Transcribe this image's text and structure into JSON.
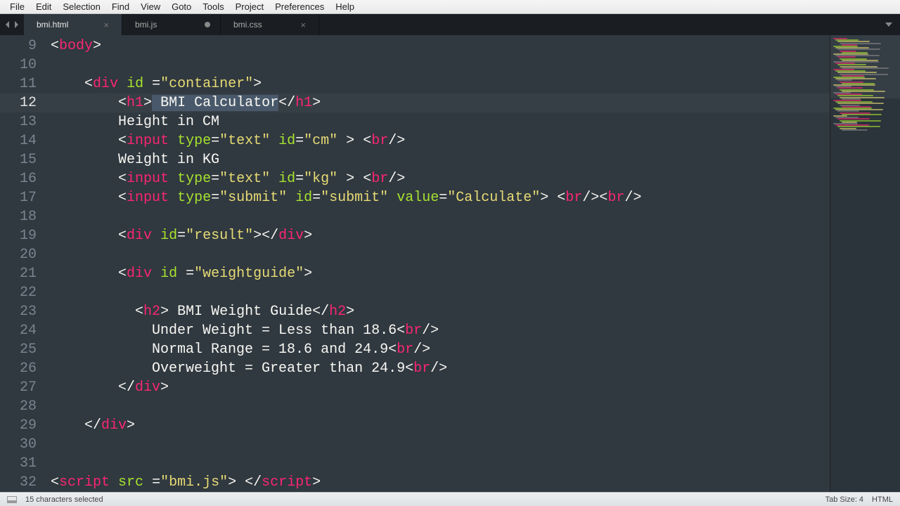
{
  "menu": {
    "items": [
      "File",
      "Edit",
      "Selection",
      "Find",
      "View",
      "Goto",
      "Tools",
      "Project",
      "Preferences",
      "Help"
    ]
  },
  "tabs": {
    "items": [
      {
        "label": "bmi.html",
        "active": true,
        "dirty": false
      },
      {
        "label": "bmi.js",
        "active": false,
        "dirty": true
      },
      {
        "label": "bmi.css",
        "active": false,
        "dirty": false
      }
    ]
  },
  "editor": {
    "first_line": 9,
    "active_line": 12,
    "selection_text": " BMI Calculator",
    "lines": [
      {
        "n": 9,
        "tokens": [
          [
            "<",
            "punct"
          ],
          [
            "body",
            "tag"
          ],
          [
            ">",
            "punct"
          ]
        ]
      },
      {
        "n": 10,
        "tokens": []
      },
      {
        "n": 11,
        "tokens": [
          [
            "    ",
            "plain"
          ],
          [
            "<",
            "punct"
          ],
          [
            "div",
            "tag"
          ],
          [
            " ",
            "plain"
          ],
          [
            "id",
            "attr"
          ],
          [
            " =",
            "plain"
          ],
          [
            "\"container\"",
            "str"
          ],
          [
            ">",
            "punct"
          ]
        ]
      },
      {
        "n": 12,
        "tokens": [
          [
            "        ",
            "plain"
          ],
          [
            "<",
            "punct"
          ],
          [
            "h1",
            "tag"
          ],
          [
            ">",
            "punct"
          ],
          [
            " BMI Calculator",
            "plain",
            "sel"
          ],
          [
            "</",
            "punct"
          ],
          [
            "h1",
            "tag"
          ],
          [
            ">",
            "punct"
          ]
        ]
      },
      {
        "n": 13,
        "tokens": [
          [
            "        Height in CM",
            "plain"
          ]
        ]
      },
      {
        "n": 14,
        "tokens": [
          [
            "        ",
            "plain"
          ],
          [
            "<",
            "punct"
          ],
          [
            "input",
            "tag"
          ],
          [
            " ",
            "plain"
          ],
          [
            "type",
            "attr"
          ],
          [
            "=",
            "plain"
          ],
          [
            "\"text\"",
            "str"
          ],
          [
            " ",
            "plain"
          ],
          [
            "id",
            "attr"
          ],
          [
            "=",
            "plain"
          ],
          [
            "\"cm\"",
            "str"
          ],
          [
            " > ",
            "plain"
          ],
          [
            "<",
            "punct"
          ],
          [
            "br",
            "tag"
          ],
          [
            "/>",
            "punct"
          ]
        ]
      },
      {
        "n": 15,
        "tokens": [
          [
            "        Weight in KG",
            "plain"
          ]
        ]
      },
      {
        "n": 16,
        "tokens": [
          [
            "        ",
            "plain"
          ],
          [
            "<",
            "punct"
          ],
          [
            "input",
            "tag"
          ],
          [
            " ",
            "plain"
          ],
          [
            "type",
            "attr"
          ],
          [
            "=",
            "plain"
          ],
          [
            "\"text\"",
            "str"
          ],
          [
            " ",
            "plain"
          ],
          [
            "id",
            "attr"
          ],
          [
            "=",
            "plain"
          ],
          [
            "\"kg\"",
            "str"
          ],
          [
            " > ",
            "plain"
          ],
          [
            "<",
            "punct"
          ],
          [
            "br",
            "tag"
          ],
          [
            "/>",
            "punct"
          ]
        ]
      },
      {
        "n": 17,
        "tokens": [
          [
            "        ",
            "plain"
          ],
          [
            "<",
            "punct"
          ],
          [
            "input",
            "tag"
          ],
          [
            " ",
            "plain"
          ],
          [
            "type",
            "attr"
          ],
          [
            "=",
            "plain"
          ],
          [
            "\"submit\"",
            "str"
          ],
          [
            " ",
            "plain"
          ],
          [
            "id",
            "attr"
          ],
          [
            "=",
            "plain"
          ],
          [
            "\"submit\"",
            "str"
          ],
          [
            " ",
            "plain"
          ],
          [
            "value",
            "attr"
          ],
          [
            "=",
            "plain"
          ],
          [
            "\"Calculate\"",
            "str"
          ],
          [
            "> ",
            "plain"
          ],
          [
            "<",
            "punct"
          ],
          [
            "br",
            "tag"
          ],
          [
            "/><",
            "punct"
          ],
          [
            "br",
            "tag"
          ],
          [
            "/>",
            "punct"
          ]
        ]
      },
      {
        "n": 18,
        "tokens": []
      },
      {
        "n": 19,
        "tokens": [
          [
            "        ",
            "plain"
          ],
          [
            "<",
            "punct"
          ],
          [
            "div",
            "tag"
          ],
          [
            " ",
            "plain"
          ],
          [
            "id",
            "attr"
          ],
          [
            "=",
            "plain"
          ],
          [
            "\"result\"",
            "str"
          ],
          [
            "></",
            "punct"
          ],
          [
            "div",
            "tag"
          ],
          [
            ">",
            "punct"
          ]
        ]
      },
      {
        "n": 20,
        "tokens": []
      },
      {
        "n": 21,
        "tokens": [
          [
            "        ",
            "plain"
          ],
          [
            "<",
            "punct"
          ],
          [
            "div",
            "tag"
          ],
          [
            " ",
            "plain"
          ],
          [
            "id",
            "attr"
          ],
          [
            " =",
            "plain"
          ],
          [
            "\"weightguide\"",
            "str"
          ],
          [
            ">",
            "punct"
          ]
        ]
      },
      {
        "n": 22,
        "tokens": []
      },
      {
        "n": 23,
        "tokens": [
          [
            "          ",
            "plain"
          ],
          [
            "<",
            "punct"
          ],
          [
            "h2",
            "tag"
          ],
          [
            "> BMI Weight Guide</",
            "punct"
          ],
          [
            "h2",
            "tag"
          ],
          [
            ">",
            "punct"
          ]
        ]
      },
      {
        "n": 24,
        "tokens": [
          [
            "            Under Weight = Less than 18.6",
            "plain"
          ],
          [
            "<",
            "punct"
          ],
          [
            "br",
            "tag"
          ],
          [
            "/>",
            "punct"
          ]
        ]
      },
      {
        "n": 25,
        "tokens": [
          [
            "            Normal Range = 18.6 and 24.9",
            "plain"
          ],
          [
            "<",
            "punct"
          ],
          [
            "br",
            "tag"
          ],
          [
            "/>",
            "punct"
          ]
        ]
      },
      {
        "n": 26,
        "tokens": [
          [
            "            Overweight = Greater than 24.9",
            "plain"
          ],
          [
            "<",
            "punct"
          ],
          [
            "br",
            "tag"
          ],
          [
            "/>",
            "punct"
          ]
        ]
      },
      {
        "n": 27,
        "tokens": [
          [
            "        ",
            "plain"
          ],
          [
            "</",
            "punct"
          ],
          [
            "div",
            "tag"
          ],
          [
            ">",
            "punct"
          ]
        ]
      },
      {
        "n": 28,
        "tokens": []
      },
      {
        "n": 29,
        "tokens": [
          [
            "    ",
            "plain"
          ],
          [
            "</",
            "punct"
          ],
          [
            "div",
            "tag"
          ],
          [
            ">",
            "punct"
          ]
        ]
      },
      {
        "n": 30,
        "tokens": []
      },
      {
        "n": 31,
        "tokens": []
      },
      {
        "n": 32,
        "tokens": [
          [
            "<",
            "punct"
          ],
          [
            "script",
            "tag"
          ],
          [
            " ",
            "plain"
          ],
          [
            "src",
            "attr"
          ],
          [
            " =",
            "plain"
          ],
          [
            "\"bmi.js\"",
            "str"
          ],
          [
            "> </",
            "punct"
          ],
          [
            "script",
            "tag"
          ],
          [
            ">",
            "punct"
          ]
        ]
      }
    ]
  },
  "status": {
    "selection": "15 characters selected",
    "tab_size": "Tab Size: 4",
    "syntax": "HTML"
  },
  "colors": {
    "tag": "#f92672",
    "attr": "#a6e22e",
    "string": "#e6db74",
    "plain": "#f8f8f2",
    "bg": "#303840"
  }
}
